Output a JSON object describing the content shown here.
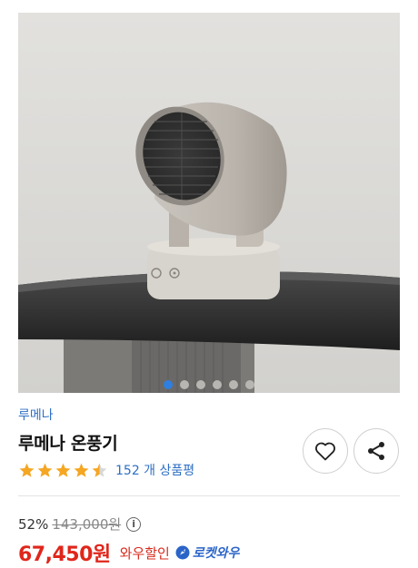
{
  "gallery": {
    "image_alt": "heater product photo",
    "dot_count": 6,
    "active_index": 0
  },
  "product": {
    "brand": "루메나",
    "title": "루메나 온풍기",
    "rating": 4.5,
    "review_count_text": "152 개 상품평"
  },
  "actions": {
    "wishlist_icon": "heart-icon",
    "share_icon": "share-icon"
  },
  "pricing": {
    "discount_rate": "52%",
    "original_price": "143,000원",
    "info_icon": "i",
    "sale_price": "67,450원",
    "wow_label": "와우할인",
    "rocket_badge": "로켓와우"
  },
  "colors": {
    "brand_blue": "#2f6fc4",
    "price_red": "#e0261b",
    "star_orange": "#f5a623",
    "active_dot": "#2f7fe0"
  }
}
